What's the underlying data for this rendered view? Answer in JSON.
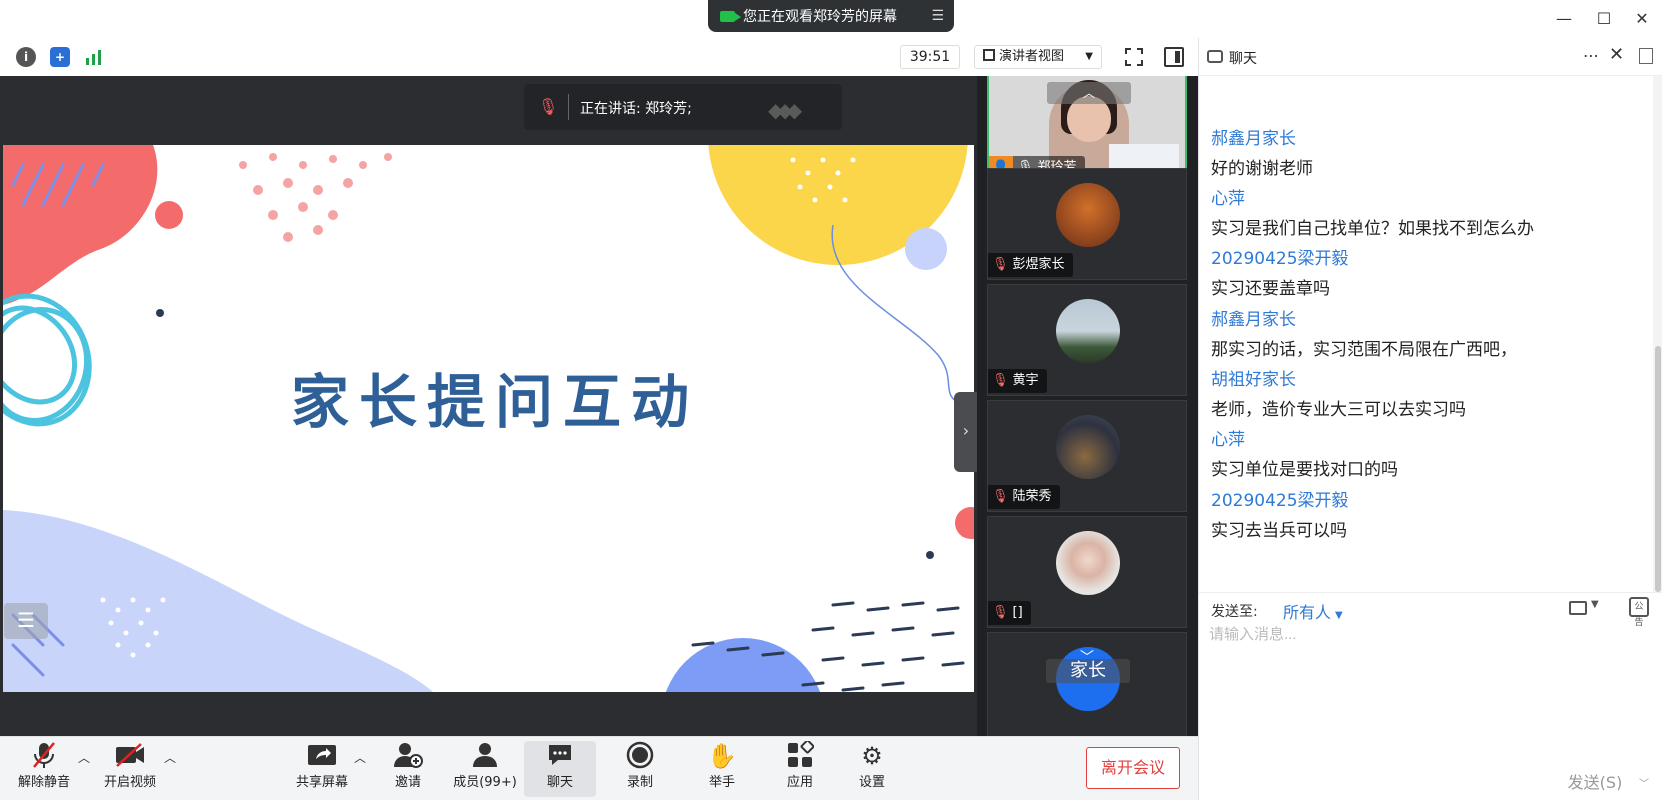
{
  "banner": {
    "text": "您正在观看郑玲芳的屏幕"
  },
  "toolbar_top": {
    "timer": "39:51",
    "view_mode": "演讲者视图"
  },
  "stage": {
    "speaking_label": "正在讲话: 郑玲芳;",
    "slide_title": "家长提问互动"
  },
  "participants": [
    {
      "name": "郑玲芳",
      "active": true
    },
    {
      "name": "彭煜家长",
      "active": false
    },
    {
      "name": "黄宇",
      "active": false
    },
    {
      "name": "陆荣秀",
      "active": false
    },
    {
      "name": "[]",
      "active": false
    },
    {
      "name": "家长",
      "active": false
    }
  ],
  "bottom_toolbar": {
    "unmute": "解除静音",
    "start_video": "开启视频",
    "share_screen": "共享屏幕",
    "invite": "邀请",
    "members": "成员(99+)",
    "chat": "聊天",
    "record": "录制",
    "raise_hand": "举手",
    "apps": "应用",
    "settings": "设置",
    "leave": "离开会议"
  },
  "chat": {
    "title": "聊天",
    "messages": [
      {
        "sender": "郝鑫月家长",
        "text": "好的谢谢老师"
      },
      {
        "sender": "心萍",
        "text": "实习是我们自己找单位？如果找不到怎么办"
      },
      {
        "sender": "20290425梁开毅",
        "text": "实习还要盖章吗"
      },
      {
        "sender": "郝鑫月家长",
        "text": "那实习的话，实习范围不局限在广西吧，"
      },
      {
        "sender": "胡祖好家长",
        "text": "老师，造价专业大三可以去实习吗"
      },
      {
        "sender": "心萍",
        "text": "实习单位是要找对口的吗"
      },
      {
        "sender": "20290425梁开毅",
        "text": "实习去当兵可以吗"
      }
    ],
    "send_to_label": "发送至:",
    "recipient": "所有人",
    "input_placeholder": "请输入消息...",
    "send_label": "发送(S)"
  },
  "colors": {
    "accent": "#2f7ad6",
    "danger": "#e34040",
    "active_border": "#3bbf6e"
  }
}
